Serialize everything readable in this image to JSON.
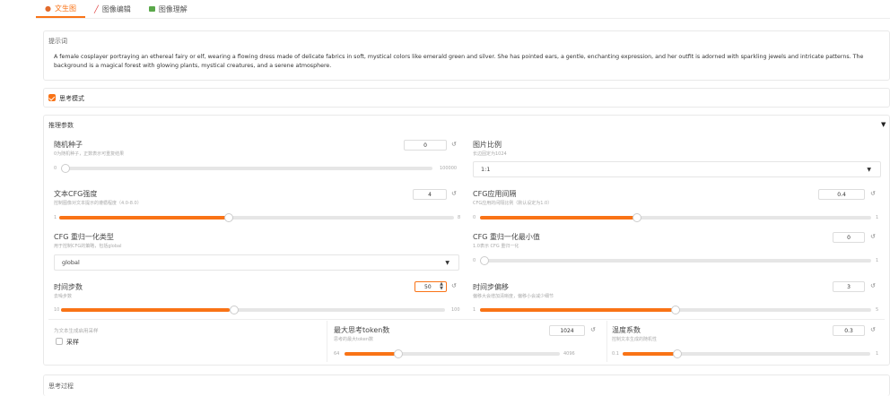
{
  "tabs": [
    {
      "label": "文生图",
      "icon": "palette-icon"
    },
    {
      "label": "图像编辑",
      "icon": "pencil-icon"
    },
    {
      "label": "图像理解",
      "icon": "image-icon"
    }
  ],
  "prompt": {
    "label": "提示词",
    "text": "A female cosplayer portraying an ethereal fairy or elf, wearing a flowing dress made of delicate fabrics in soft, mystical colors like emerald green and silver. She has pointed ears, a gentle, enchanting expression, and her outfit is adorned with sparkling jewels and intricate patterns. The background is a magical forest with glowing plants, mystical creatures, and a serene atmosphere."
  },
  "thinking_mode": {
    "label": "思考模式",
    "checked": true
  },
  "params": {
    "label": "推理参数",
    "seed": {
      "title": "随机种子",
      "sub": "0为随机种子，正数表示可重复结果",
      "value": "0",
      "min": "0",
      "max": "100000",
      "fraction": 0.0
    },
    "aspect": {
      "title": "图片比例",
      "sub": "长边固定为1024",
      "value": "1:1"
    },
    "text_cfg": {
      "title": "文本CFG强度",
      "sub": "控制图像对文本提示的遵循程度（4.0-8.0）",
      "value": "4",
      "min": "1",
      "max": "8",
      "fraction": 0.43
    },
    "cfg_interval": {
      "title": "CFG应用间隔",
      "sub": "CFG应用的间隔比例（默认设定为1.0）",
      "value": "0.4",
      "min": "0",
      "max": "1",
      "fraction": 0.4
    },
    "cfg_norm_type": {
      "title": "CFG 重归一化类型",
      "sub": "用于控制CFG的策略，包括global",
      "value": "global"
    },
    "cfg_norm_min": {
      "title": "CFG 重归一化最小值",
      "sub": "1.0表示 CFG 重归一化",
      "value": "0",
      "min": "0",
      "max": "1",
      "fraction": 0.0
    },
    "steps": {
      "title": "时间步数",
      "sub": "去噪步数",
      "value": "50",
      "min": "10",
      "max": "100",
      "fraction": 0.44
    },
    "shift": {
      "title": "时间步偏移",
      "sub": "偏移大会增加清晰度，偏移小会减少细节",
      "value": "3",
      "min": "1",
      "max": "5",
      "fraction": 0.5
    },
    "sampling": {
      "title": "为文本生成启用采样",
      "checkbox_label": "采样",
      "checked": false
    },
    "max_tokens": {
      "title": "最大思考token数",
      "sub": "思考的最大token数",
      "value": "1024",
      "min": "64",
      "max": "4096",
      "fraction": 0.24
    },
    "temperature": {
      "title": "温度系数",
      "sub": "控制文本生成的随机性",
      "value": "0.3",
      "min": "0.1",
      "max": "1",
      "fraction": 0.22
    }
  },
  "thinking_process": {
    "label": "思考过程"
  },
  "colors": {
    "accent": "#f97316"
  }
}
